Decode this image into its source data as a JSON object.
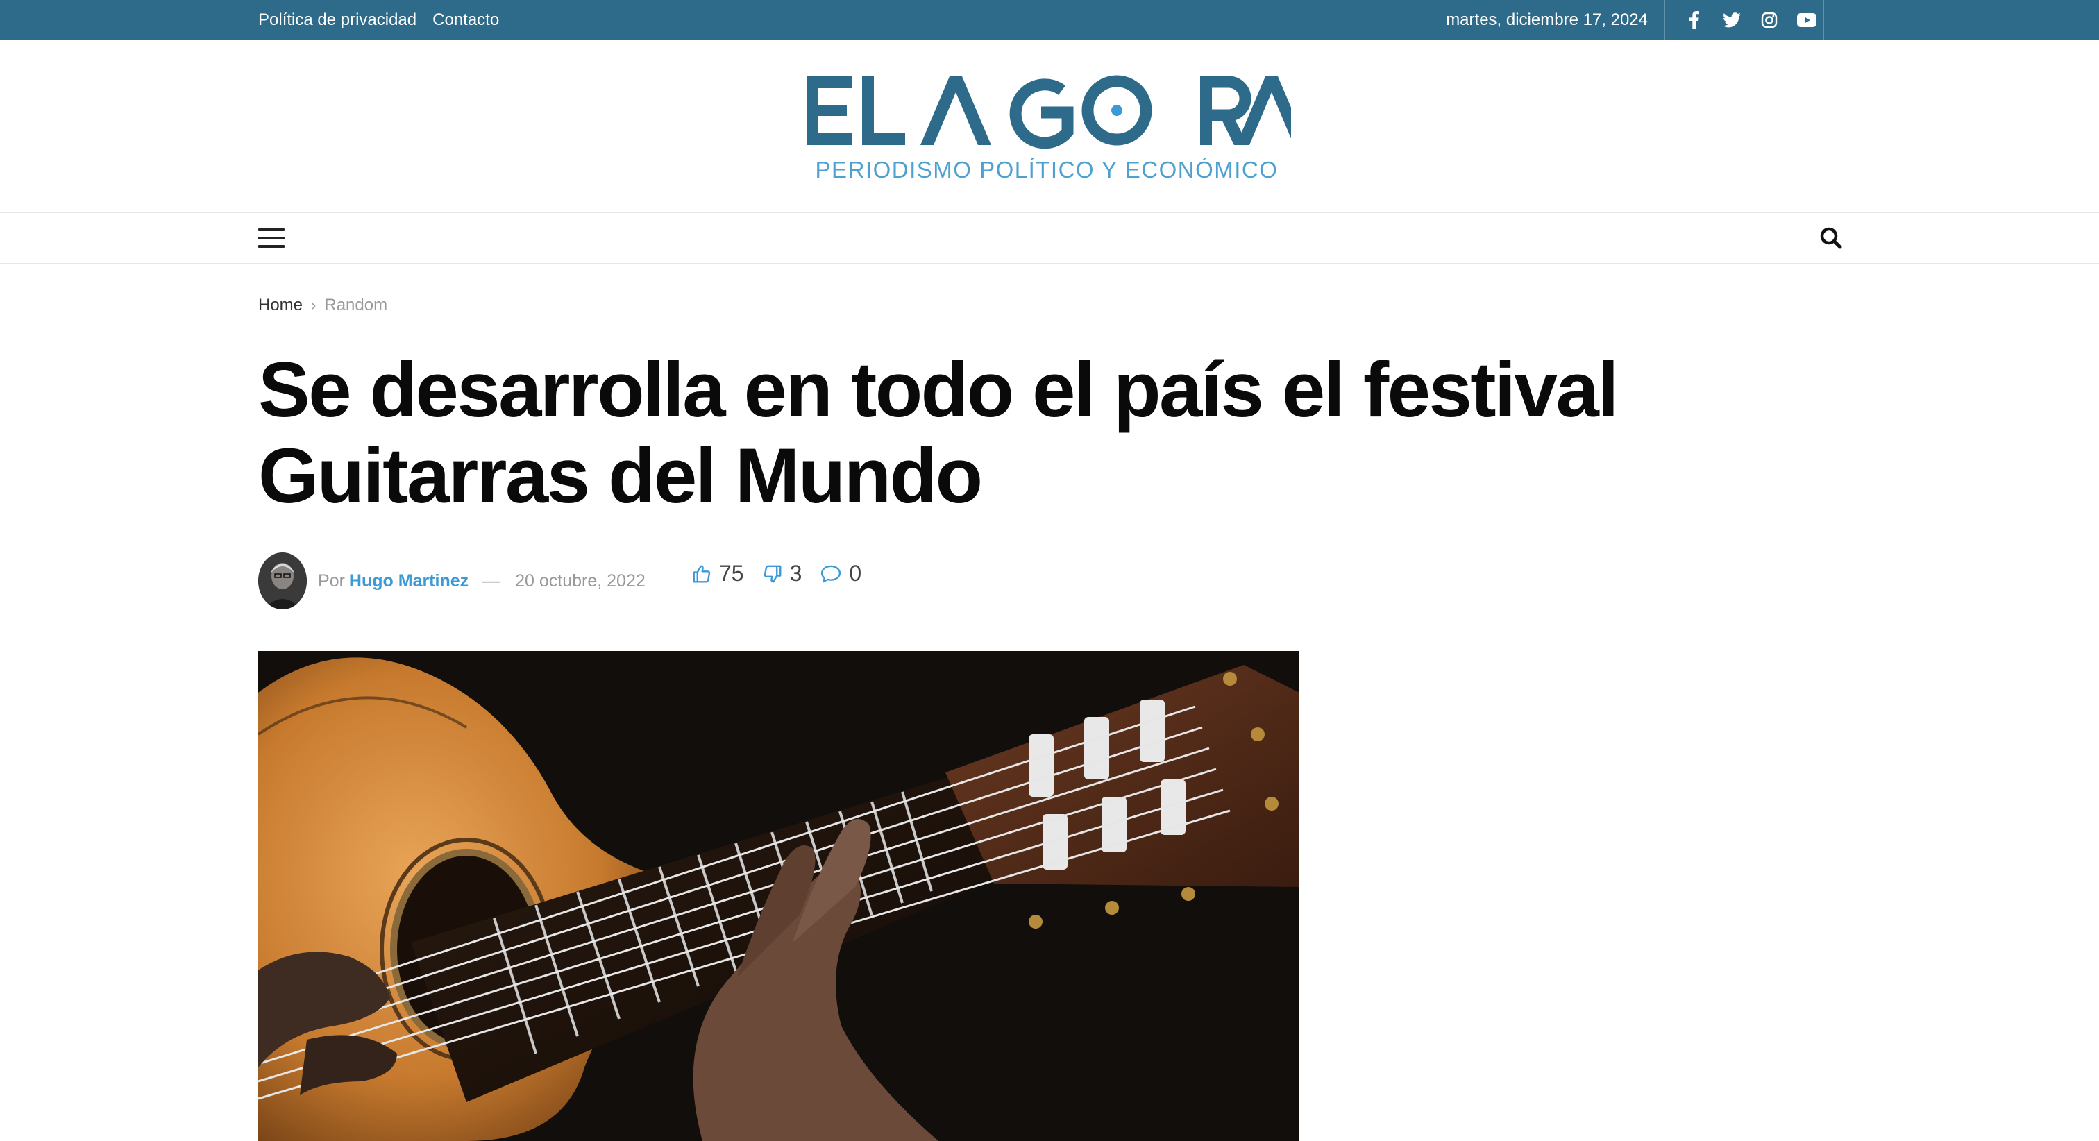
{
  "topbar": {
    "links": [
      "Política de privacidad",
      "Contacto"
    ],
    "date": "martes, diciembre 17, 2024",
    "social_icons": [
      "facebook-icon",
      "twitter-icon",
      "instagram-icon",
      "youtube-icon"
    ],
    "color": "#2e6b8a"
  },
  "logo": {
    "wordmark": "EL AGORA",
    "tagline": "PERIODISMO POLÍTICO Y ECONÓMICO",
    "color_main": "#2e6b8a",
    "color_tagline": "#4ea1cf"
  },
  "nav": {
    "menu_icon": "hamburger-icon",
    "search_icon": "search-icon"
  },
  "breadcrumb": {
    "home": "Home",
    "current": "Random"
  },
  "article": {
    "title": "Se desarrolla en todo el país el festival Guitarras del Mundo",
    "by_label": "Por",
    "author": "Hugo Martinez",
    "dash": "—",
    "date": "20 octubre, 2022",
    "likes": "75",
    "dislikes": "3",
    "comments": "0",
    "accent": "#3b9ad6"
  }
}
